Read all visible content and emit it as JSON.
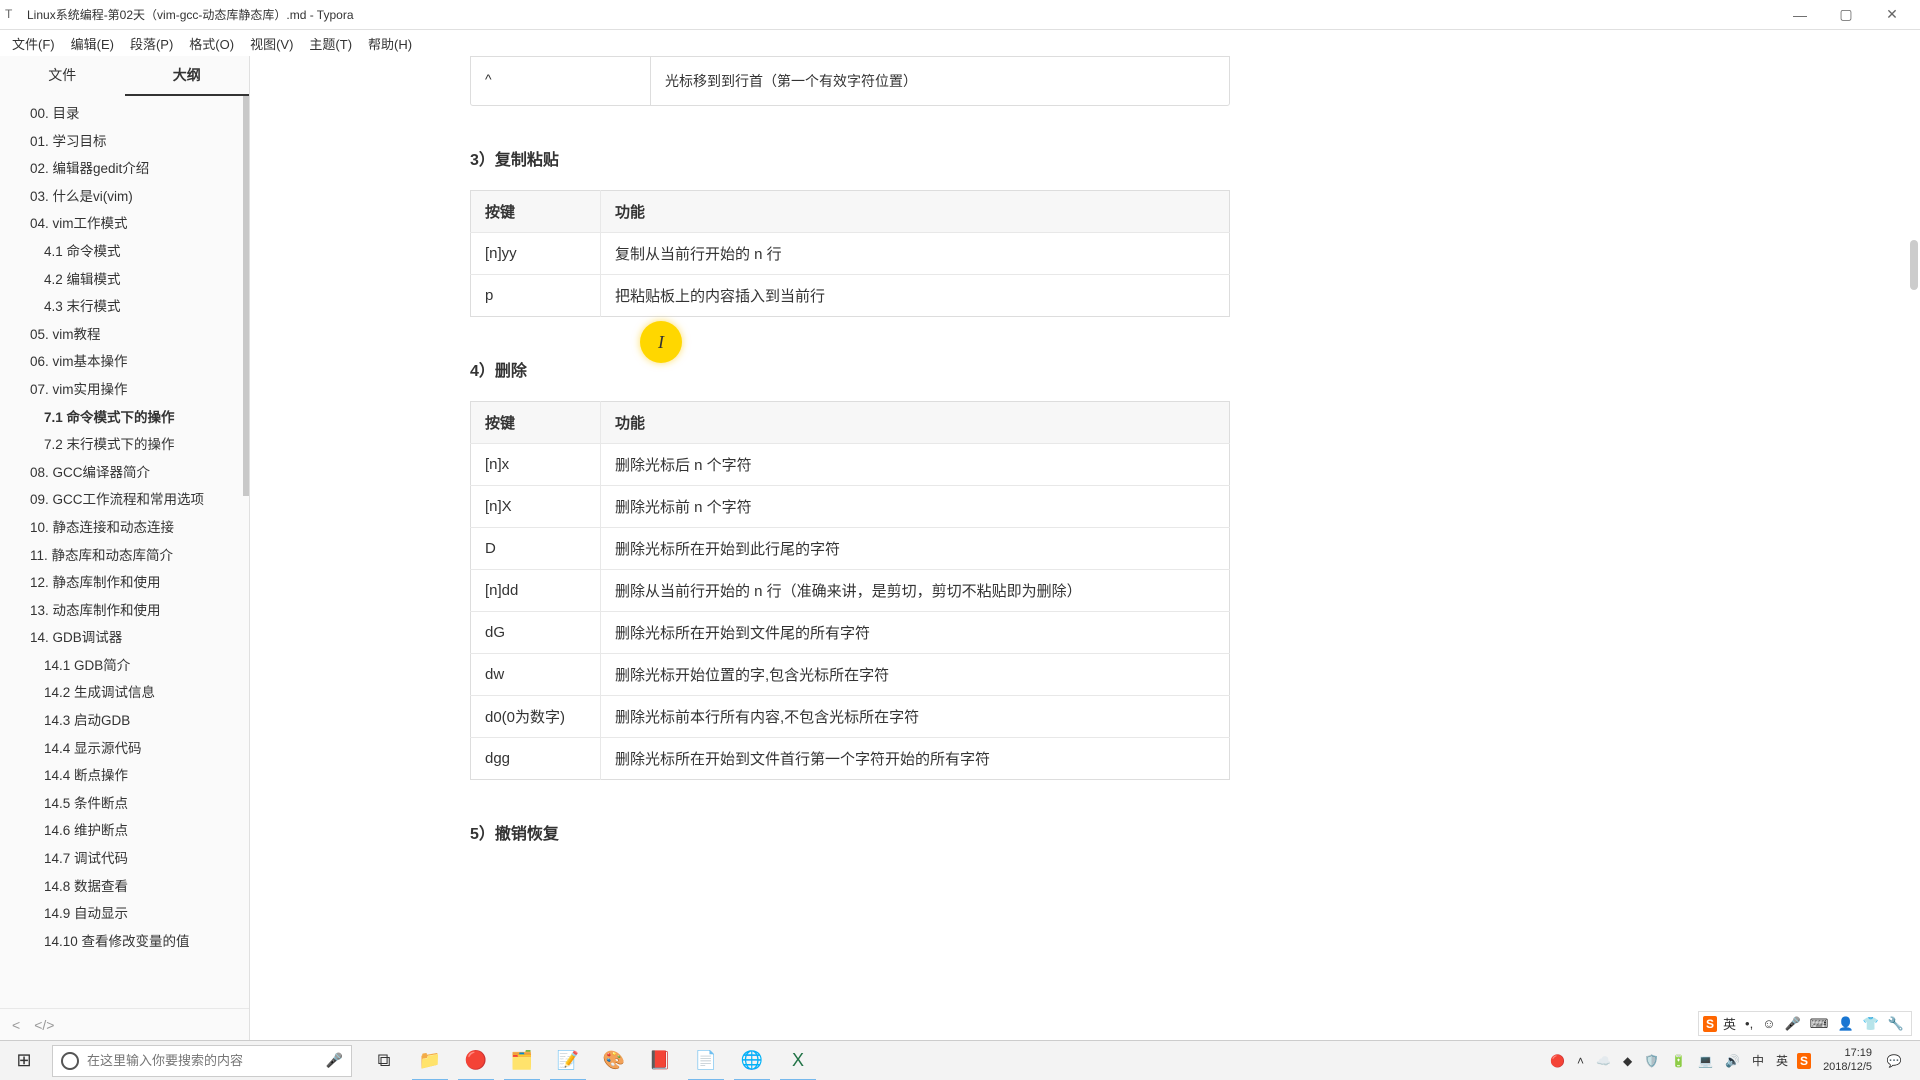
{
  "window": {
    "title": "Linux系统编程-第02天（vim-gcc-动态库静态库）.md - Typora"
  },
  "menubar": [
    "文件(F)",
    "编辑(E)",
    "段落(P)",
    "格式(O)",
    "视图(V)",
    "主题(T)",
    "帮助(H)"
  ],
  "sidebar": {
    "tabs": {
      "files": "文件",
      "outline": "大纲"
    },
    "items": [
      "00. 目录",
      "01. 学习目标",
      "02. 编辑器gedit介绍",
      "03. 什么是vi(vim)",
      "04. vim工作模式",
      "4.1 命令模式",
      "4.2 编辑模式",
      "4.3 末行模式",
      "05. vim教程",
      "06. vim基本操作",
      "07. vim实用操作",
      "7.1 命令模式下的操作",
      "7.2 末行模式下的操作",
      "08. GCC编译器简介",
      "09. GCC工作流程和常用选项",
      "10. 静态连接和动态连接",
      "11. 静态库和动态库简介",
      "12. 静态库制作和使用",
      "13. 动态库制作和使用",
      "14. GDB调试器",
      "14.1 GDB简介",
      "14.2 生成调试信息",
      "14.3 启动GDB",
      "14.4 显示源代码",
      "14.4 断点操作",
      "14.5 条件断点",
      "14.6 维护断点",
      "14.7 调试代码",
      "14.8 数据查看",
      "14.9 自动显示",
      "14.10 查看修改变量的值"
    ],
    "levels": [
      0,
      0,
      0,
      0,
      0,
      1,
      1,
      1,
      0,
      0,
      0,
      1,
      1,
      0,
      0,
      0,
      0,
      0,
      0,
      0,
      1,
      1,
      1,
      1,
      1,
      1,
      1,
      1,
      1,
      1,
      1
    ],
    "current": 11
  },
  "doc": {
    "caret_key": "^",
    "caret_desc": "光标移到到行首（第一个有效字符位置）",
    "h3": "3）复制粘贴",
    "t3_h1": "按键",
    "t3_h2": "功能",
    "t3_r1_k": "[n]yy",
    "t3_r1_v": "复制从当前行开始的 n 行",
    "t3_r2_k": "p",
    "t3_r2_v": "把粘贴板上的内容插入到当前行",
    "h4": "4）删除",
    "t4_h1": "按键",
    "t4_h2": "功能",
    "t4": [
      {
        "k": "[n]x",
        "v": "删除光标后 n 个字符"
      },
      {
        "k": "[n]X",
        "v": "删除光标前 n 个字符"
      },
      {
        "k": "D",
        "v": "删除光标所在开始到此行尾的字符"
      },
      {
        "k": "[n]dd",
        "v": "删除从当前行开始的 n 行（准确来讲，是剪切，剪切不粘贴即为删除）"
      },
      {
        "k": "dG",
        "v": "删除光标所在开始到文件尾的所有字符"
      },
      {
        "k": "dw",
        "v": "删除光标开始位置的字,包含光标所在字符"
      },
      {
        "k": "d0(0为数字)",
        "v": "删除光标前本行所有内容,不包含光标所在字符"
      },
      {
        "k": "dgg",
        "v": "删除光标所在开始到文件首行第一个字符开始的所有字符"
      }
    ],
    "h5": "5）撤销恢复"
  },
  "search": {
    "placeholder": "在这里输入你要搜索的内容"
  },
  "tray": {
    "time": "17:19",
    "date": "2018/12/5",
    "ime_lang": "英",
    "ime_mode": "中"
  },
  "ime": {
    "lang": "英"
  }
}
